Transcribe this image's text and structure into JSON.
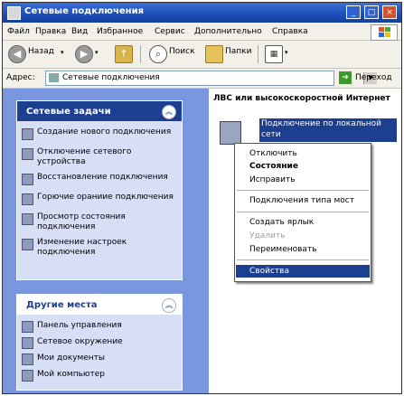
{
  "window": {
    "title": "Сетевые подключения"
  },
  "title_buttons": [
    "_",
    "□",
    "×"
  ],
  "menu": [
    "Файл",
    "Правка",
    "Вид",
    "Избранное",
    "Сервис",
    "Дополнительно",
    "Справка"
  ],
  "toolbar": {
    "back": "Назад",
    "search": "Поиск",
    "folders": "Папки"
  },
  "address": {
    "label": "Адрес:",
    "value": "Сетевые подключения",
    "go": "Переход"
  },
  "tasks_panel": {
    "title": "Сетевые задачи",
    "items": [
      "Создание нового подключения",
      "Отключение сетевого устройства",
      "Восстановление подключения",
      "Горючие ораниие подключения",
      "Просмотр состояния подключения",
      "Изменение настроек подключения"
    ]
  },
  "places_panel": {
    "title": "Другие места",
    "items": [
      "Панель управления",
      "Сетевое окружение",
      "Мои документы",
      "Мой компьютер"
    ]
  },
  "content": {
    "section_title": "ЛВС или высокоскоростной Интернет",
    "connection_label": "Подключение по локальной сети"
  },
  "context_menu": {
    "items": [
      "Отключить",
      "Состояние",
      "Исправить",
      "Подключения типа мост",
      "Создать ярлык",
      "Удалить",
      "Переименовать",
      "Свойства"
    ]
  },
  "colors": {
    "title_blue": "#1a4fb9",
    "pane_blue": "#7a96df",
    "selection": "#1d3f8f"
  }
}
